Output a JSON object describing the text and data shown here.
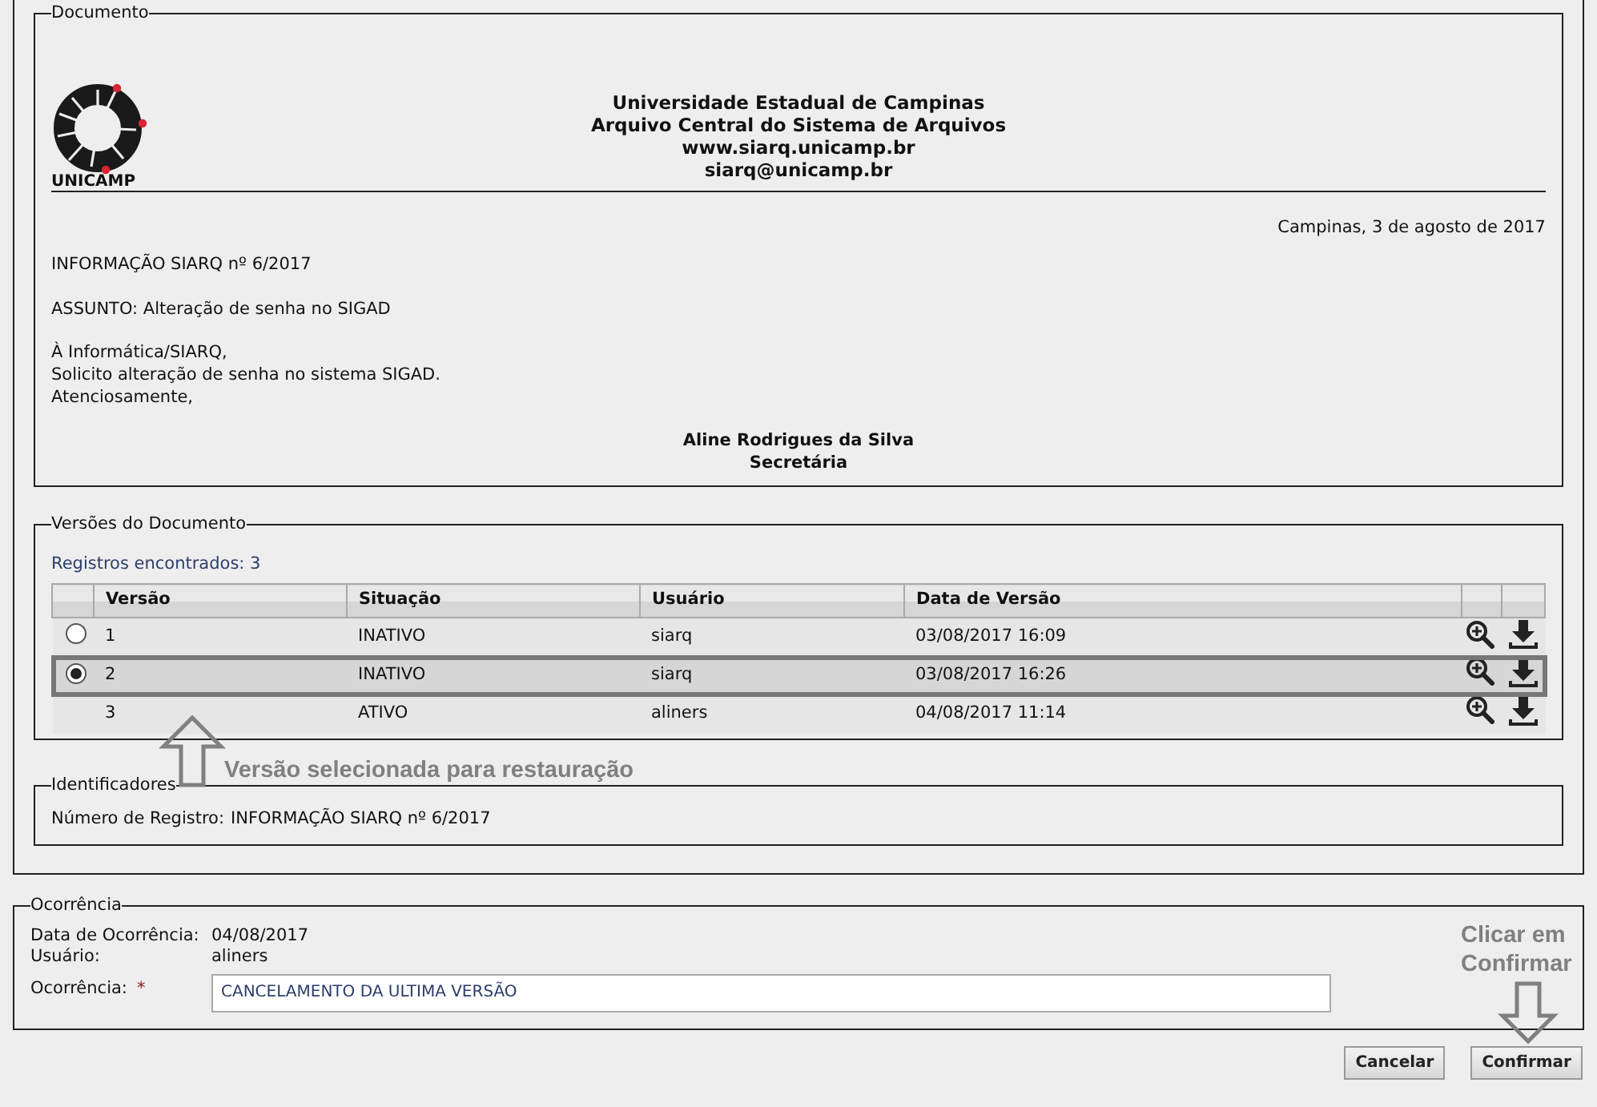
{
  "document": {
    "legend": "Documento",
    "logo_text": "UNICAMP",
    "header_lines": [
      "Universidade Estadual de Campinas",
      "Arquivo Central do Sistema de Arquivos",
      "www.siarq.unicamp.br",
      "siarq@unicamp.br"
    ],
    "place_date": "Campinas, 3 de agosto de 2017",
    "info_number": "INFORMAÇÃO SIARQ nº 6/2017",
    "subject": "ASSUNTO: Alteração de senha no SIGAD",
    "body_lines": [
      "À Informática/SIARQ,",
      "Solicito alteração de senha no sistema SIGAD.",
      "Atenciosamente,"
    ],
    "signer_name": "Aline Rodrigues da Silva",
    "signer_role": "Secretária"
  },
  "versions": {
    "legend": "Versões do Documento",
    "records_found": "Registros encontrados: 3",
    "columns": [
      "Versão",
      "Situação",
      "Usuário",
      "Data de Versão"
    ],
    "rows": [
      {
        "kind": "radio",
        "selected": false,
        "version": "1",
        "status": "INATIVO",
        "user": "siarq",
        "date": "03/08/2017 16:09"
      },
      {
        "kind": "radio",
        "selected": true,
        "version": "2",
        "status": "INATIVO",
        "user": "siarq",
        "date": "03/08/2017 16:26"
      },
      {
        "kind": "plain",
        "selected": false,
        "version": "3",
        "status": "ATIVO",
        "user": "aliners",
        "date": "04/08/2017 11:14"
      }
    ]
  },
  "identifiers": {
    "legend": "Identificadores",
    "label": "Número de Registro:",
    "value": "INFORMAÇÃO SIARQ nº 6/2017"
  },
  "occurrence": {
    "legend": "Ocorrência",
    "date_label": "Data de Ocorrência:",
    "date_value": "04/08/2017",
    "user_label": "Usuário:",
    "user_value": "aliners",
    "field_label": "Ocorrência:",
    "required_mark": "*",
    "field_value": "CANCELAMENTO DA ULTIMA VERSÃO"
  },
  "annotations": [
    {
      "kind": "up",
      "text": "Versão selecionada para restauração"
    },
    {
      "kind": "down",
      "text": "Clicar em Confirmar"
    }
  ],
  "buttons": [
    "Cancelar",
    "Confirmar"
  ]
}
